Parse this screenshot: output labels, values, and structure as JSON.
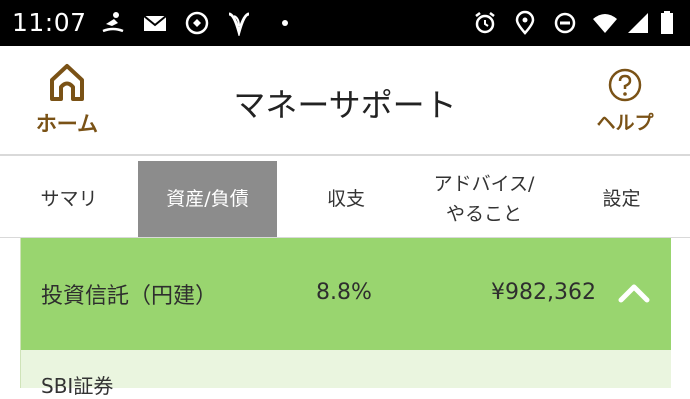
{
  "status_bar": {
    "time": "11:07",
    "left_icons": [
      "surf-icon",
      "mail-icon",
      "sync-app-icon",
      "v-logo-icon",
      "dot-icon"
    ],
    "right_icons": [
      "alarm-icon",
      "location-icon",
      "dnd-icon",
      "wifi-icon",
      "signal-icon",
      "battery-icon"
    ]
  },
  "header": {
    "home_label": "ホーム",
    "title": "マネーサポート",
    "help_label": "ヘルプ",
    "accent_color": "#7a5216"
  },
  "tabs": [
    {
      "label": "サマリ",
      "active": false
    },
    {
      "label": "資産/負債",
      "active": true
    },
    {
      "label": "収支",
      "active": false
    },
    {
      "label": "アドバイス/\nやること",
      "active": false
    },
    {
      "label": "設定",
      "active": false
    }
  ],
  "asset_section": {
    "name": "投資信託（円建）",
    "percent": "8.8%",
    "amount": "¥982,362",
    "expanded": true,
    "row_color": "#99d56f",
    "sub_items": [
      {
        "label": "SBI証券"
      }
    ]
  }
}
